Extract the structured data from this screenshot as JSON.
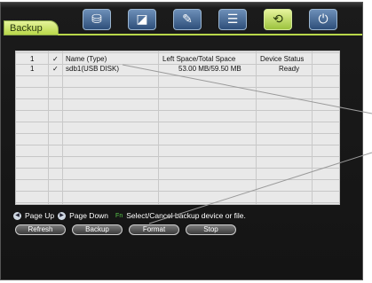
{
  "tab": {
    "label": "Backup"
  },
  "toolbar": {
    "icons": [
      "disk-icon",
      "camera-icon",
      "tools-icon",
      "list-icon",
      "backup-icon",
      "power-icon"
    ],
    "active_index": 4
  },
  "table": {
    "header": {
      "index": "1",
      "check": "✓",
      "name": "Name (Type)",
      "space": "Left Space/Total Space",
      "status": "Device Status"
    },
    "rows": [
      {
        "index": "1",
        "check": "✓",
        "name": "sdb1(USB DISK)",
        "space": "53.00 MB/59.50 MB",
        "status": "Ready"
      }
    ]
  },
  "hint": {
    "page_up": "Page Up",
    "page_down": "Page Down",
    "fn_key": "Fn",
    "select_text": "Select/Cancel backup device or file."
  },
  "buttons": {
    "refresh": "Refresh",
    "backup": "Backup",
    "format": "Format",
    "stop": "Stop"
  },
  "colors": {
    "accent": "#b9d84a",
    "background": "#141414",
    "list_bg": "#e9e9e9"
  }
}
